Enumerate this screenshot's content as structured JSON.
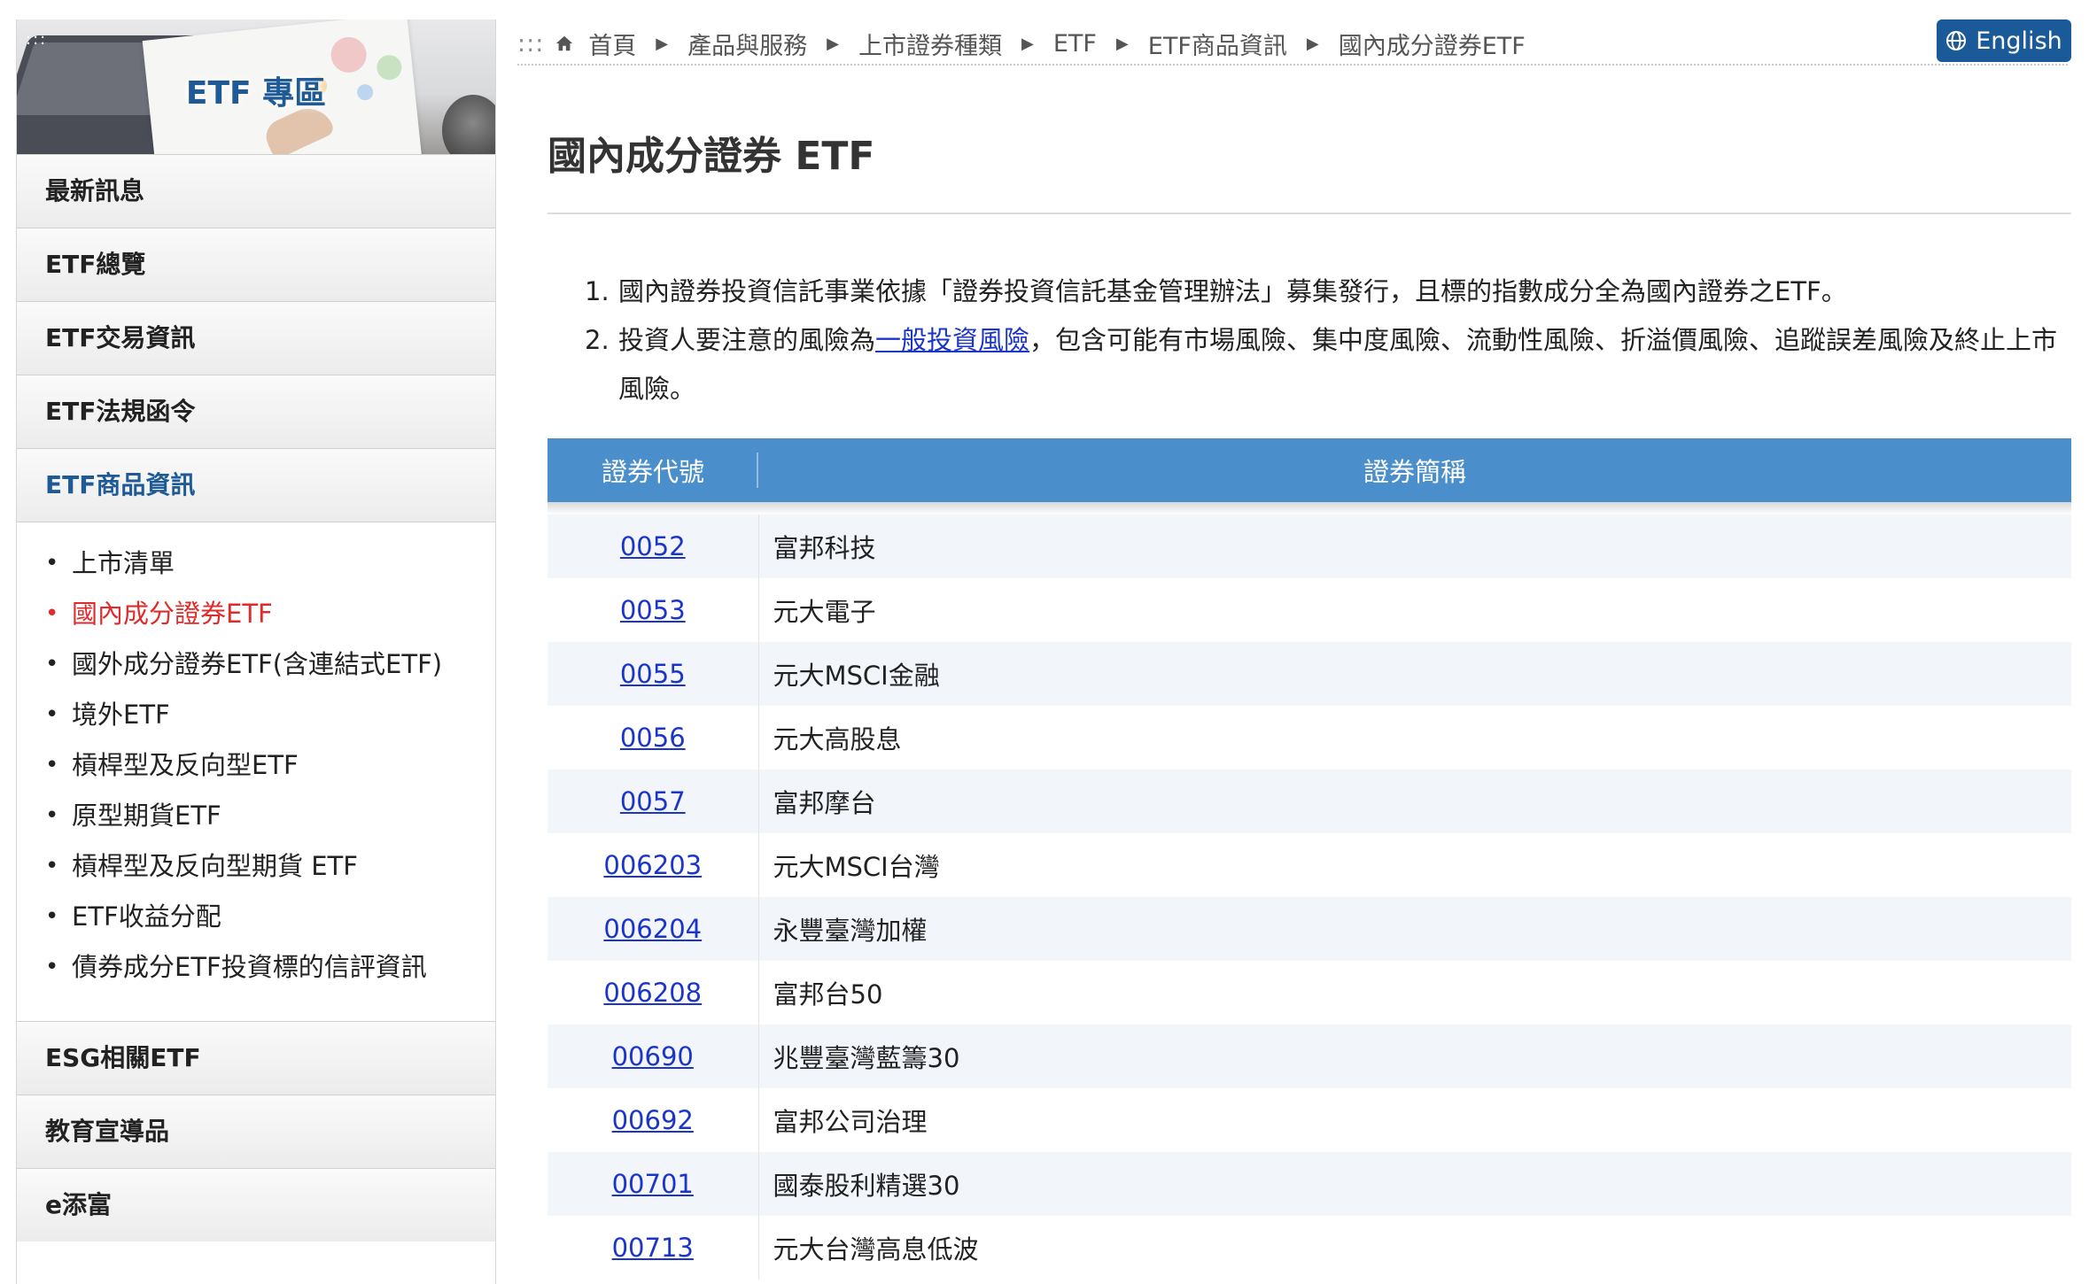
{
  "sidebar": {
    "banner": {
      "dots": ":::",
      "title": "ETF 專區"
    },
    "menu_top": [
      "最新訊息",
      "ETF總覽",
      "ETF交易資訊",
      "ETF法規函令",
      "ETF商品資訊"
    ],
    "submenu": [
      "上市清單",
      "國內成分證券ETF",
      "國外成分證券ETF(含連結式ETF)",
      "境外ETF",
      "槓桿型及反向型ETF",
      "原型期貨ETF",
      "槓桿型及反向型期貨 ETF",
      "ETF收益分配",
      "債券成分ETF投資標的信評資訊"
    ],
    "menu_bottom": [
      "ESG相關ETF",
      "教育宣導品",
      "e添富"
    ]
  },
  "breadcrumb": {
    "lead": ":::",
    "items": [
      "首頁",
      "產品與服務",
      "上市證券種類",
      "ETF",
      "ETF商品資訊",
      "國內成分證券ETF"
    ]
  },
  "language_button": "English",
  "page_title": "國內成分證券 ETF",
  "notes": {
    "item1_num": "1.",
    "item1": "國內證券投資信託事業依據「證券投資信託基金管理辦法」募集發行，且標的指數成分全為國內證券之ETF。",
    "item2_num": "2.",
    "item2_pre": "投資人要注意的風險為",
    "item2_link": "一般投資風險",
    "item2_post": "，包含可能有市場風險、集中度風險、流動性風險、折溢價風險、追蹤誤差風險及終止上市風險。"
  },
  "table": {
    "headers": {
      "code": "證券代號",
      "name": "證券簡稱"
    },
    "rows": [
      {
        "code": "0052",
        "name": "富邦科技"
      },
      {
        "code": "0053",
        "name": "元大電子"
      },
      {
        "code": "0055",
        "name": "元大MSCI金融"
      },
      {
        "code": "0056",
        "name": "元大高股息"
      },
      {
        "code": "0057",
        "name": "富邦摩台"
      },
      {
        "code": "006203",
        "name": "元大MSCI台灣"
      },
      {
        "code": "006204",
        "name": "永豐臺灣加權"
      },
      {
        "code": "006208",
        "name": "富邦台50"
      },
      {
        "code": "00690",
        "name": "兆豐臺灣藍籌30"
      },
      {
        "code": "00692",
        "name": "富邦公司治理"
      },
      {
        "code": "00701",
        "name": "國泰股利精選30"
      },
      {
        "code": "00713",
        "name": "元大台灣高息低波"
      }
    ]
  },
  "colors": {
    "brand_blue": "#1a5a99",
    "table_header": "#4a8fcb",
    "active_red": "#e02b2b",
    "link": "#1a35c8"
  },
  "icons": {
    "breadcrumb_home": "home-icon",
    "language": "globe-icon"
  }
}
